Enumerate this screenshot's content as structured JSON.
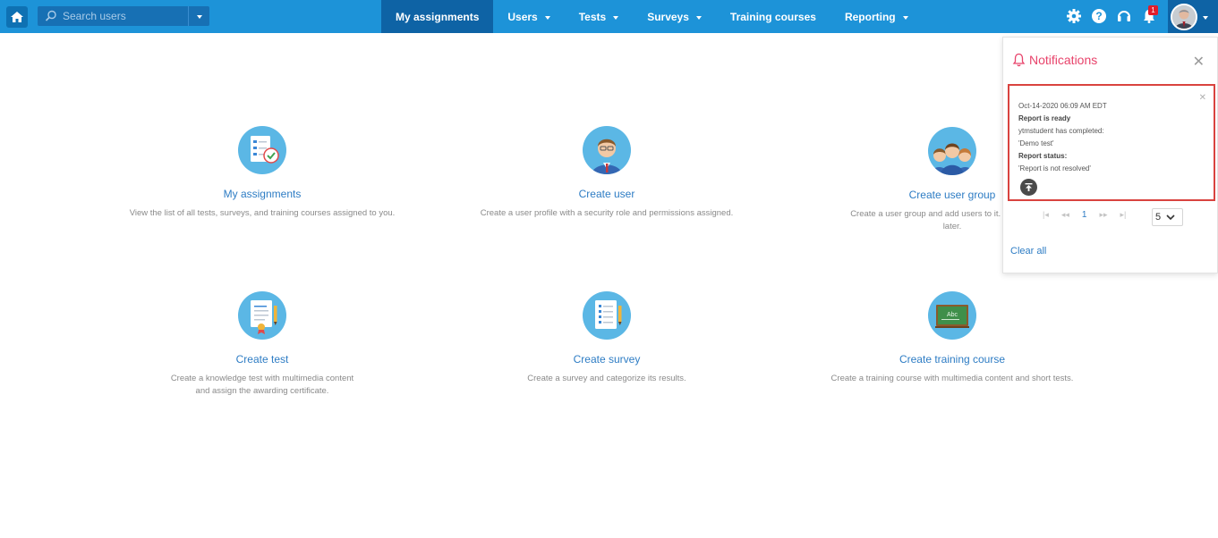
{
  "search": {
    "placeholder": "Search users"
  },
  "nav": {
    "items": [
      {
        "label": "My assignments",
        "active": true,
        "dropdown": false
      },
      {
        "label": "Users",
        "dropdown": true
      },
      {
        "label": "Tests",
        "dropdown": true
      },
      {
        "label": "Surveys",
        "dropdown": true
      },
      {
        "label": "Training courses",
        "dropdown": false
      },
      {
        "label": "Reporting",
        "dropdown": true
      }
    ]
  },
  "topbar": {
    "notification_count": "1",
    "icons": [
      "gear-icon",
      "help-icon",
      "headset-icon",
      "bell-icon"
    ]
  },
  "tiles": [
    {
      "title": "My assignments",
      "desc": "View the list of all tests, surveys, and training courses assigned to you.",
      "icon": "assignments-icon"
    },
    {
      "title": "Create user",
      "desc": "Create a user profile with a security role and permissions assigned.",
      "icon": "user-icon"
    },
    {
      "title": "Create user group",
      "desc": "Create a user group and add users to it. Organize a te",
      "desc2": "later.",
      "icon": "user-group-icon"
    },
    {
      "title": "Create test",
      "desc": "Create a knowledge test with multimedia content",
      "desc2": "and assign the awarding certificate.",
      "icon": "test-icon"
    },
    {
      "title": "Create survey",
      "desc": "Create a survey and categorize its results.",
      "icon": "survey-icon"
    },
    {
      "title": "Create training course",
      "desc": "Create a training course with multimedia content and short tests.",
      "icon": "training-icon"
    }
  ],
  "notifications": {
    "title": "Notifications",
    "item": {
      "date": "Oct-14-2020 06:09 AM EDT",
      "heading": "Report is ready",
      "line1": "ytmstudent has completed:",
      "line2": "'Demo test'",
      "status_label": "Report status:",
      "status_value": "'Report is not resolved'"
    },
    "pager": {
      "current": "1",
      "page_size": "5"
    },
    "clear_all": "Clear all"
  },
  "colors": {
    "topbar": "#1d93d8",
    "active_nav": "#0e63a5",
    "accent": "#2d7cc4",
    "notif_title": "#e8436b",
    "highlight": "#d9433f"
  }
}
